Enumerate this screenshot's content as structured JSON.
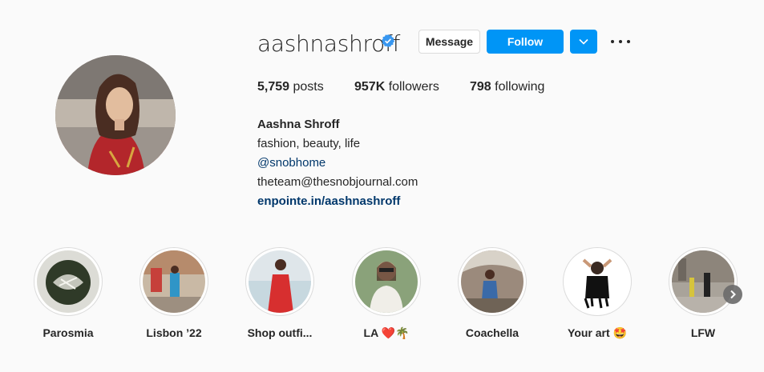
{
  "profile": {
    "username": "aashnashroff",
    "verified": true,
    "display_name": "Aashna Shroff",
    "bio_lines": [
      "fashion, beauty, life"
    ],
    "mention": "@snobhome",
    "email": "theteam@thesnobjournal.com",
    "website": "enpointe.in/aashnashroff"
  },
  "actions": {
    "message_label": "Message",
    "follow_label": "Follow"
  },
  "stats": {
    "posts_count": "5,759",
    "posts_label": "posts",
    "followers_count": "957K",
    "followers_label": "followers",
    "following_count": "798",
    "following_label": "following"
  },
  "highlights": [
    {
      "label": "Parosmia",
      "icon": "food-photo"
    },
    {
      "label": "Lisbon ’22",
      "icon": "street-photo"
    },
    {
      "label": "Shop outfi...",
      "icon": "red-dress-photo"
    },
    {
      "label": "LA ❤️🌴",
      "icon": "portrait-photo"
    },
    {
      "label": "Coachella",
      "icon": "festival-photo"
    },
    {
      "label": "Your art 🤩",
      "icon": "illustration-photo"
    },
    {
      "label": "LFW",
      "icon": "street-style-photo"
    }
  ],
  "colors": {
    "accent": "#0095f6",
    "link": "#00376b",
    "verified": "#3897f0",
    "background": "#fafafa"
  }
}
